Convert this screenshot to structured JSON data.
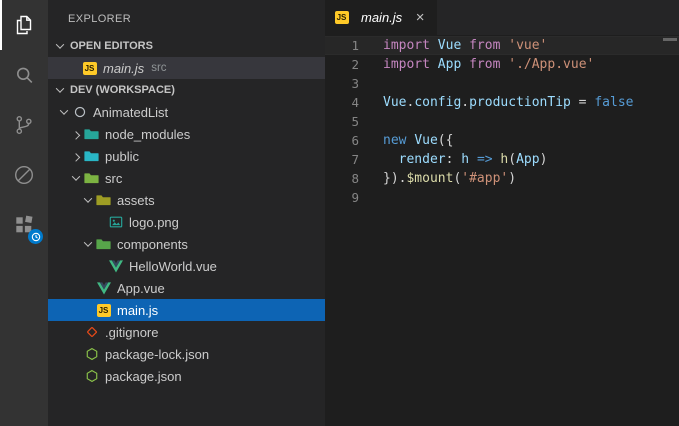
{
  "colors": {
    "selection_bg": "#0d64b4",
    "open_editor_row_bg": "#37373d",
    "activity_badge": "#007acc",
    "syntax": {
      "k1": "#c586c0",
      "k2": "#569cd6",
      "id": "#9cdcfe",
      "str": "#ce9178",
      "fn": "#dcdcaa",
      "pl": "#d4d4d4"
    },
    "file_colors": {
      "js": "#ffca28",
      "vue_green": "#41b883",
      "vue_dark": "#35495e",
      "git": "#e64a19",
      "npm": "#8bc34a",
      "image": "#26a69a",
      "root": "#b9bfc4"
    }
  },
  "icons": {
    "close": "×"
  },
  "activity_bar": {
    "items": [
      {
        "id": "explorer",
        "icon": "files-icon",
        "active": true
      },
      {
        "id": "search",
        "icon": "search-icon",
        "active": false
      },
      {
        "id": "source-control",
        "icon": "git-branch-icon",
        "active": false
      },
      {
        "id": "debug",
        "icon": "debug-icon",
        "active": false
      },
      {
        "id": "extensions",
        "icon": "extensions-icon",
        "active": false,
        "badge": "clock-icon"
      }
    ]
  },
  "sidebar": {
    "title": "EXPLORER",
    "open_editors": {
      "label": "OPEN EDITORS",
      "items": [
        {
          "label": "main.js",
          "detail": "src",
          "icon": "js",
          "preview": true
        }
      ]
    },
    "workspace": {
      "label": "DEV (WORKSPACE)",
      "items": [
        {
          "label": "AnimatedList",
          "level": 1,
          "arrow": "expanded",
          "icon": "root"
        },
        {
          "label": "node_modules",
          "level": 2,
          "arrow": "collapsed",
          "icon": "folder",
          "color": "#26a69a"
        },
        {
          "label": "public",
          "level": 2,
          "arrow": "collapsed",
          "icon": "folder",
          "color": "#29b6c5"
        },
        {
          "label": "src",
          "level": 2,
          "arrow": "expanded",
          "icon": "folder",
          "color": "#7cb342"
        },
        {
          "label": "assets",
          "level": 3,
          "arrow": "expanded",
          "icon": "folder",
          "color": "#9e9d24"
        },
        {
          "label": "logo.png",
          "level": 4,
          "arrow": "none",
          "icon": "image"
        },
        {
          "label": "components",
          "level": 3,
          "arrow": "expanded",
          "icon": "folder",
          "color": "#57a64a"
        },
        {
          "label": "HelloWorld.vue",
          "level": 4,
          "arrow": "none",
          "icon": "vue"
        },
        {
          "label": "App.vue",
          "level": 3,
          "arrow": "none",
          "icon": "vue"
        },
        {
          "label": "main.js",
          "level": 3,
          "arrow": "none",
          "icon": "js",
          "selected": true
        },
        {
          "label": ".gitignore",
          "level": 2,
          "arrow": "none",
          "icon": "git"
        },
        {
          "label": "package-lock.json",
          "level": 2,
          "arrow": "none",
          "icon": "npm"
        },
        {
          "label": "package.json",
          "level": 2,
          "arrow": "none",
          "icon": "npm"
        }
      ]
    }
  },
  "editor": {
    "tab": {
      "label": "main.js",
      "icon": "js",
      "preview": true
    },
    "current_line": 1,
    "lines": [
      {
        "num": "1",
        "tokens": [
          [
            "import ",
            "k1"
          ],
          [
            "Vue ",
            "id"
          ],
          [
            "from ",
            "k1"
          ],
          [
            "'vue'",
            "str"
          ]
        ]
      },
      {
        "num": "2",
        "tokens": [
          [
            "import ",
            "k1"
          ],
          [
            "App ",
            "id"
          ],
          [
            "from ",
            "k1"
          ],
          [
            "'./App.vue'",
            "str"
          ]
        ]
      },
      {
        "num": "3",
        "tokens": []
      },
      {
        "num": "4",
        "tokens": [
          [
            "Vue",
            "id"
          ],
          [
            ".",
            "pl"
          ],
          [
            "config",
            "id"
          ],
          [
            ".",
            "pl"
          ],
          [
            "productionTip",
            "id"
          ],
          [
            " = ",
            "pl"
          ],
          [
            "false",
            "k2"
          ]
        ]
      },
      {
        "num": "5",
        "tokens": []
      },
      {
        "num": "6",
        "tokens": [
          [
            "new ",
            "k2"
          ],
          [
            "Vue",
            "id"
          ],
          [
            "({",
            "pl"
          ]
        ]
      },
      {
        "num": "7",
        "tokens": [
          [
            "  render",
            "id"
          ],
          [
            ": ",
            "pl"
          ],
          [
            "h",
            "id"
          ],
          [
            " ",
            "pl"
          ],
          [
            "=>",
            "k2"
          ],
          [
            " ",
            "pl"
          ],
          [
            "h",
            "fn"
          ],
          [
            "(",
            "pl"
          ],
          [
            "App",
            "id"
          ],
          [
            ")",
            "pl"
          ]
        ]
      },
      {
        "num": "8",
        "tokens": [
          [
            "})",
            "pl"
          ],
          [
            ".",
            "pl"
          ],
          [
            "$mount",
            "fn"
          ],
          [
            "(",
            "pl"
          ],
          [
            "'#app'",
            "str"
          ],
          [
            ")",
            "pl"
          ]
        ]
      },
      {
        "num": "9",
        "tokens": []
      }
    ]
  }
}
